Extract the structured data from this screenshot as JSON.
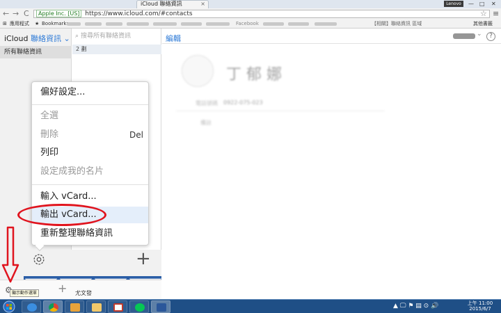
{
  "browser": {
    "tab_title": "iCloud 聯絡資訊",
    "tab_close": "×",
    "user_badge": "Lenovo",
    "window_controls": {
      "minimize": "—",
      "maximize": "□",
      "close": "✕"
    },
    "nav": {
      "back": "←",
      "forward": "→",
      "reload": "C"
    },
    "ev_label": "Apple Inc. [US]",
    "url": "https://www.icloud.com/#contacts",
    "star": "☆",
    "menu": "≡"
  },
  "bookmarks": {
    "apps": "應用程式",
    "bookmarks": "Bookmarks",
    "item_facebook": "Facebook",
    "item_blurry": "【相關】聯絡資訊 區域",
    "other": "其他書籤"
  },
  "icloud": {
    "brand": "iCloud",
    "section": "聯絡資訊",
    "section_chevron": "⌄",
    "group_all": "所有聯絡資訊",
    "search_placeholder": "搜尋所有聯絡資訊",
    "count": "2 劃",
    "edit": "編輯",
    "help": "?",
    "contact": {
      "name": "丁 郁 娜",
      "phone_label": "電話號碼",
      "phone_value": "0922-075-023",
      "note": "備註"
    }
  },
  "context_menu": {
    "preferences": "偏好設定...",
    "select_all": "全選",
    "delete": "刪除",
    "delete_key": "Del",
    "print": "列印",
    "set_my_card": "設定成我的名片",
    "import_vcard": "輸入 vCard...",
    "export_vcard": "輸出 vCard...",
    "refresh": "重新整理聯絡資訊"
  },
  "bottom": {
    "plus": "+",
    "gear_tooltip": "顯示動作選單",
    "partial_text": "尤文發"
  },
  "taskbar": {
    "tray_symbols": "▲ 🖵 ⚑ ▤ ⊙ 🔊",
    "time": "上午 11:00",
    "date": "2015/6/7"
  },
  "colors": {
    "accent": "#2f7bd7",
    "annotation": "#e0141e",
    "taskbar": "#1f4f86"
  }
}
